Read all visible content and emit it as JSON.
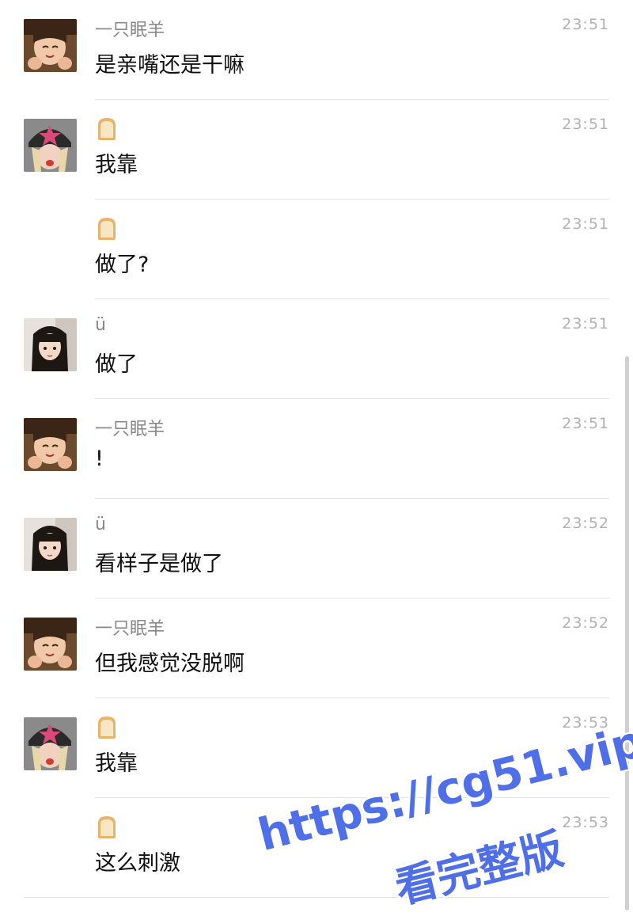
{
  "messages": [
    {
      "name": "一只眠羊",
      "avatar": "avatar-girl-hands",
      "time": "23:51",
      "text": "是亲嘴还是干嘛"
    },
    {
      "name": "",
      "name_icon": "bread-emoji",
      "avatar": "avatar-girl-beanie",
      "time": "23:51",
      "text": "我靠"
    },
    {
      "name": "",
      "name_icon": "bread-emoji",
      "avatar": "",
      "time": "23:51",
      "text": "做了?"
    },
    {
      "name": "ü",
      "avatar": "avatar-girl-bangs",
      "time": "23:51",
      "text": "做了"
    },
    {
      "name": "一只眠羊",
      "avatar": "avatar-girl-hands",
      "time": "23:51",
      "text": "!"
    },
    {
      "name": "ü",
      "avatar": "avatar-girl-bangs",
      "time": "23:52",
      "text": "看样子是做了"
    },
    {
      "name": "一只眠羊",
      "avatar": "avatar-girl-hands",
      "time": "23:52",
      "text": "但我感觉没脱啊"
    },
    {
      "name": "",
      "name_icon": "bread-emoji",
      "avatar": "avatar-girl-beanie",
      "time": "23:53",
      "text": "我靠"
    },
    {
      "name": "",
      "name_icon": "bread-emoji",
      "avatar": "",
      "time": "23:53",
      "text": "这么刺激"
    }
  ],
  "watermark": {
    "line1": "https://cg51.vip",
    "line2": "看完整版"
  },
  "colors": {
    "name": "#888888",
    "time": "#b2b2b2",
    "text": "#111111",
    "divider": "#e3e3e3",
    "watermark": "#4f6fe8"
  }
}
